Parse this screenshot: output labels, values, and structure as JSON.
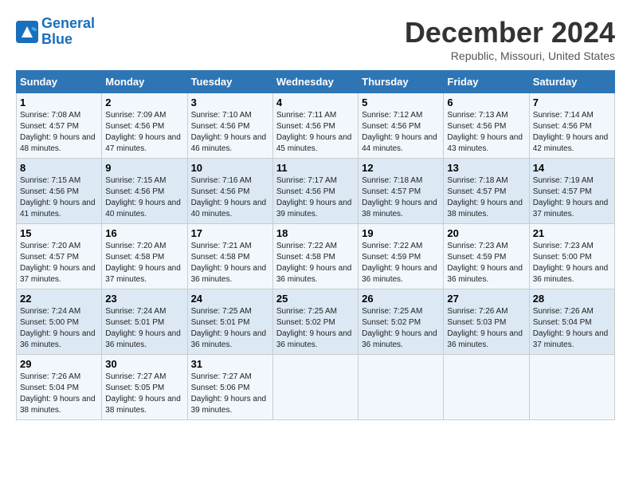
{
  "logo": {
    "line1": "General",
    "line2": "Blue"
  },
  "title": "December 2024",
  "location": "Republic, Missouri, United States",
  "headers": [
    "Sunday",
    "Monday",
    "Tuesday",
    "Wednesday",
    "Thursday",
    "Friday",
    "Saturday"
  ],
  "weeks": [
    [
      {
        "day": "1",
        "sunrise": "7:08 AM",
        "sunset": "4:57 PM",
        "daylight": "9 hours and 48 minutes."
      },
      {
        "day": "2",
        "sunrise": "7:09 AM",
        "sunset": "4:56 PM",
        "daylight": "9 hours and 47 minutes."
      },
      {
        "day": "3",
        "sunrise": "7:10 AM",
        "sunset": "4:56 PM",
        "daylight": "9 hours and 46 minutes."
      },
      {
        "day": "4",
        "sunrise": "7:11 AM",
        "sunset": "4:56 PM",
        "daylight": "9 hours and 45 minutes."
      },
      {
        "day": "5",
        "sunrise": "7:12 AM",
        "sunset": "4:56 PM",
        "daylight": "9 hours and 44 minutes."
      },
      {
        "day": "6",
        "sunrise": "7:13 AM",
        "sunset": "4:56 PM",
        "daylight": "9 hours and 43 minutes."
      },
      {
        "day": "7",
        "sunrise": "7:14 AM",
        "sunset": "4:56 PM",
        "daylight": "9 hours and 42 minutes."
      }
    ],
    [
      {
        "day": "8",
        "sunrise": "7:15 AM",
        "sunset": "4:56 PM",
        "daylight": "9 hours and 41 minutes."
      },
      {
        "day": "9",
        "sunrise": "7:15 AM",
        "sunset": "4:56 PM",
        "daylight": "9 hours and 40 minutes."
      },
      {
        "day": "10",
        "sunrise": "7:16 AM",
        "sunset": "4:56 PM",
        "daylight": "9 hours and 40 minutes."
      },
      {
        "day": "11",
        "sunrise": "7:17 AM",
        "sunset": "4:56 PM",
        "daylight": "9 hours and 39 minutes."
      },
      {
        "day": "12",
        "sunrise": "7:18 AM",
        "sunset": "4:57 PM",
        "daylight": "9 hours and 38 minutes."
      },
      {
        "day": "13",
        "sunrise": "7:18 AM",
        "sunset": "4:57 PM",
        "daylight": "9 hours and 38 minutes."
      },
      {
        "day": "14",
        "sunrise": "7:19 AM",
        "sunset": "4:57 PM",
        "daylight": "9 hours and 37 minutes."
      }
    ],
    [
      {
        "day": "15",
        "sunrise": "7:20 AM",
        "sunset": "4:57 PM",
        "daylight": "9 hours and 37 minutes."
      },
      {
        "day": "16",
        "sunrise": "7:20 AM",
        "sunset": "4:58 PM",
        "daylight": "9 hours and 37 minutes."
      },
      {
        "day": "17",
        "sunrise": "7:21 AM",
        "sunset": "4:58 PM",
        "daylight": "9 hours and 36 minutes."
      },
      {
        "day": "18",
        "sunrise": "7:22 AM",
        "sunset": "4:58 PM",
        "daylight": "9 hours and 36 minutes."
      },
      {
        "day": "19",
        "sunrise": "7:22 AM",
        "sunset": "4:59 PM",
        "daylight": "9 hours and 36 minutes."
      },
      {
        "day": "20",
        "sunrise": "7:23 AM",
        "sunset": "4:59 PM",
        "daylight": "9 hours and 36 minutes."
      },
      {
        "day": "21",
        "sunrise": "7:23 AM",
        "sunset": "5:00 PM",
        "daylight": "9 hours and 36 minutes."
      }
    ],
    [
      {
        "day": "22",
        "sunrise": "7:24 AM",
        "sunset": "5:00 PM",
        "daylight": "9 hours and 36 minutes."
      },
      {
        "day": "23",
        "sunrise": "7:24 AM",
        "sunset": "5:01 PM",
        "daylight": "9 hours and 36 minutes."
      },
      {
        "day": "24",
        "sunrise": "7:25 AM",
        "sunset": "5:01 PM",
        "daylight": "9 hours and 36 minutes."
      },
      {
        "day": "25",
        "sunrise": "7:25 AM",
        "sunset": "5:02 PM",
        "daylight": "9 hours and 36 minutes."
      },
      {
        "day": "26",
        "sunrise": "7:25 AM",
        "sunset": "5:02 PM",
        "daylight": "9 hours and 36 minutes."
      },
      {
        "day": "27",
        "sunrise": "7:26 AM",
        "sunset": "5:03 PM",
        "daylight": "9 hours and 36 minutes."
      },
      {
        "day": "28",
        "sunrise": "7:26 AM",
        "sunset": "5:04 PM",
        "daylight": "9 hours and 37 minutes."
      }
    ],
    [
      {
        "day": "29",
        "sunrise": "7:26 AM",
        "sunset": "5:04 PM",
        "daylight": "9 hours and 38 minutes."
      },
      {
        "day": "30",
        "sunrise": "7:27 AM",
        "sunset": "5:05 PM",
        "daylight": "9 hours and 38 minutes."
      },
      {
        "day": "31",
        "sunrise": "7:27 AM",
        "sunset": "5:06 PM",
        "daylight": "9 hours and 39 minutes."
      },
      null,
      null,
      null,
      null
    ]
  ]
}
